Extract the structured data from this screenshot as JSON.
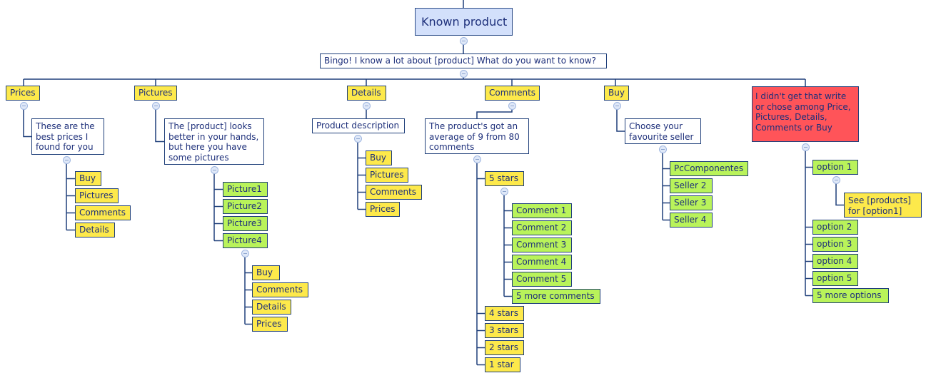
{
  "diagram": {
    "root": {
      "label": "Known product"
    },
    "prompt": {
      "label": "Bingo! I know a lot about [product] What do you want to know?"
    },
    "branches": [
      {
        "label": "Prices",
        "response": "These are the best prices I found for you",
        "children": [
          {
            "label": "Buy"
          },
          {
            "label": "Pictures"
          },
          {
            "label": "Comments"
          },
          {
            "label": "Details"
          }
        ]
      },
      {
        "label": "Pictures",
        "response": "The [product] looks better in your hands, but here you have some pictures",
        "children": [
          {
            "label": "Picture1"
          },
          {
            "label": "Picture2"
          },
          {
            "label": "Picture3"
          },
          {
            "label": "Picture4",
            "children": [
              {
                "label": "Buy"
              },
              {
                "label": "Comments"
              },
              {
                "label": "Details"
              },
              {
                "label": "Prices"
              }
            ]
          }
        ]
      },
      {
        "label": "Details",
        "response": "Product description",
        "children": [
          {
            "label": "Buy"
          },
          {
            "label": "Pictures"
          },
          {
            "label": "Comments"
          },
          {
            "label": "Prices"
          }
        ]
      },
      {
        "label": "Comments",
        "response": "The product's got an average of 9 from 80 comments",
        "children": [
          {
            "label": "5 stars",
            "children": [
              {
                "label": "Comment 1"
              },
              {
                "label": "Comment 2"
              },
              {
                "label": "Comment 3"
              },
              {
                "label": "Comment 4"
              },
              {
                "label": "Comment 5"
              },
              {
                "label": "5 more comments"
              }
            ]
          },
          {
            "label": "4 stars"
          },
          {
            "label": "3 stars"
          },
          {
            "label": "2 stars"
          },
          {
            "label": "1 star"
          }
        ]
      },
      {
        "label": "Buy",
        "response": "Choose your favourite seller",
        "children": [
          {
            "label": "PcComponentes"
          },
          {
            "label": "Seller 2"
          },
          {
            "label": "Seller 3"
          },
          {
            "label": "Seller 4"
          }
        ]
      }
    ],
    "fallback": {
      "label": "I didn't get that write or chose among Price, Pictures, Details, Comments or Buy",
      "children": [
        {
          "label": "option 1",
          "children": [
            {
              "label": "See [products] for [option1]"
            }
          ]
        },
        {
          "label": "option 2"
        },
        {
          "label": "option 3"
        },
        {
          "label": "option 4"
        },
        {
          "label": "option 5"
        },
        {
          "label": "5 more options"
        }
      ]
    },
    "colors": {
      "root": "#d3e0fb",
      "question": "#ffffff",
      "menu_option": "#fde94b",
      "content_item": "#b9f35a",
      "error": "#ff5459",
      "connector": "#1f3f7a"
    }
  }
}
